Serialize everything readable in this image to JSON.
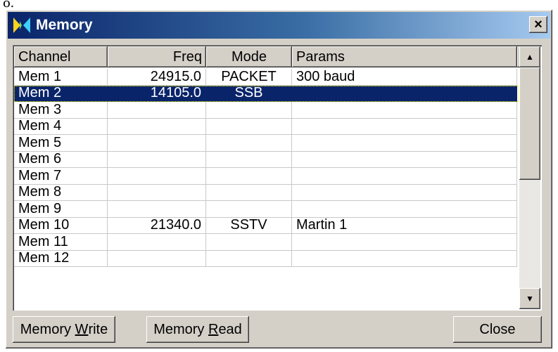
{
  "corner_mark": "o.",
  "window": {
    "title": "Memory",
    "close_label": "×"
  },
  "columns": [
    "Channel",
    "Freq",
    "Mode",
    "Params"
  ],
  "rows": [
    {
      "channel": "Mem 1",
      "freq": "24915.0",
      "mode": "PACKET",
      "params": "300 baud"
    },
    {
      "channel": "Mem 2",
      "freq": "14105.0",
      "mode": "SSB",
      "params": "",
      "selected": true
    },
    {
      "channel": "Mem 3",
      "freq": "",
      "mode": "",
      "params": ""
    },
    {
      "channel": "Mem 4",
      "freq": "",
      "mode": "",
      "params": ""
    },
    {
      "channel": "Mem 5",
      "freq": "",
      "mode": "",
      "params": ""
    },
    {
      "channel": "Mem 6",
      "freq": "",
      "mode": "",
      "params": ""
    },
    {
      "channel": "Mem 7",
      "freq": "",
      "mode": "",
      "params": ""
    },
    {
      "channel": "Mem 8",
      "freq": "",
      "mode": "",
      "params": ""
    },
    {
      "channel": "Mem 9",
      "freq": "",
      "mode": "",
      "params": ""
    },
    {
      "channel": "Mem 10",
      "freq": "21340.0",
      "mode": "SSTV",
      "params": "Martin 1"
    },
    {
      "channel": "Mem 11",
      "freq": "",
      "mode": "",
      "params": ""
    },
    {
      "channel": "Mem 12",
      "freq": "",
      "mode": "",
      "params": ""
    }
  ],
  "buttons": {
    "write": {
      "prefix": "Memory ",
      "accel": "W",
      "suffix": "rite"
    },
    "read": {
      "prefix": "Memory ",
      "accel": "R",
      "suffix": "ead"
    },
    "close": "Close"
  },
  "scrollbar": {
    "up_glyph": "▲",
    "down_glyph": "▼"
  },
  "colors": {
    "title_start": "#0a246a",
    "title_end": "#a6caf0",
    "selection": "#0a246a",
    "face": "#d4d0c8"
  }
}
